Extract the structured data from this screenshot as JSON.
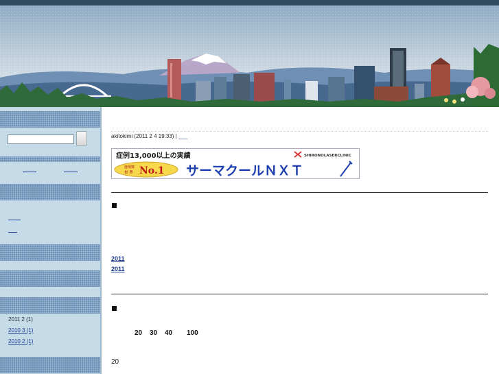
{
  "colors": {
    "topbar": "#2f4a5e",
    "sidebar_bg": "#c5dbe8",
    "sidebar_header": "#6f93b8",
    "link": "#1e3c8c",
    "ad_blue": "#1d3fb0"
  },
  "search": {
    "placeholder": ""
  },
  "sidebar": {
    "archives": [
      {
        "label": "2011 2  (1)",
        "is_link": false
      },
      {
        "label": "2010 3  (1)",
        "is_link": true
      },
      {
        "label": "2010 2  (1)",
        "is_link": true
      }
    ]
  },
  "post": {
    "meta": "akitokimi (2011 2  4  19:33) | ",
    "meta_link": "___"
  },
  "ad": {
    "headline": "症例13,000以上の実績",
    "clinic": "SHIRONOLASERCLINIC",
    "badge_small_top": "症例数",
    "badge_small_bottom": "世 界",
    "badge_big": "No.1",
    "product": "サーマクールＮＸＴ"
  },
  "related": [
    {
      "label": "2011"
    },
    {
      "label": "2011"
    }
  ],
  "stats": [
    "20",
    "30",
    "40",
    "100"
  ],
  "footer_number": "20",
  "icons": [
    "search-button-icon",
    "bullet-square-icon",
    "pen-icon",
    "clinic-logo-icon"
  ]
}
